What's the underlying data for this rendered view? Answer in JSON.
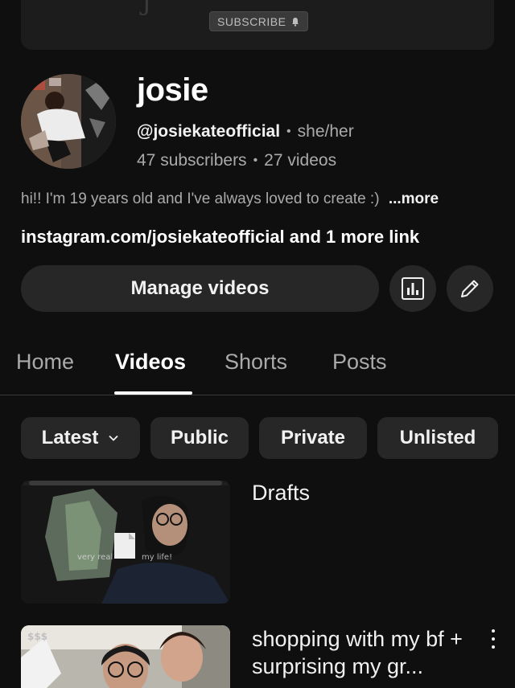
{
  "banner": {
    "subscribe_label": "SUBSCRIBE"
  },
  "channel": {
    "name": "josie",
    "handle": "@josiekateofficial",
    "pronouns": "she/her",
    "subscribers": "47 subscribers",
    "videos": "27 videos",
    "bio": "hi!! I'm 19 years old and I've always loved to create :)",
    "bio_more": "...more",
    "links": "instagram.com/josiekateofficial and 1 more link"
  },
  "actions": {
    "manage_label": "Manage videos",
    "analytics_icon": "bar-chart-icon",
    "edit_icon": "pencil-icon"
  },
  "tabs": [
    {
      "label": "Home",
      "active": false
    },
    {
      "label": "Videos",
      "active": true
    },
    {
      "label": "Shorts",
      "active": false
    },
    {
      "label": "Posts",
      "active": false
    }
  ],
  "filters": [
    {
      "label": "Latest",
      "dropdown": true
    },
    {
      "label": "Public"
    },
    {
      "label": "Private"
    },
    {
      "label": "Unlisted"
    }
  ],
  "videos": [
    {
      "title": "Drafts",
      "thumb_caption": "very real ... my life!"
    },
    {
      "title": "shopping with my bf + surprising my gr..."
    }
  ]
}
